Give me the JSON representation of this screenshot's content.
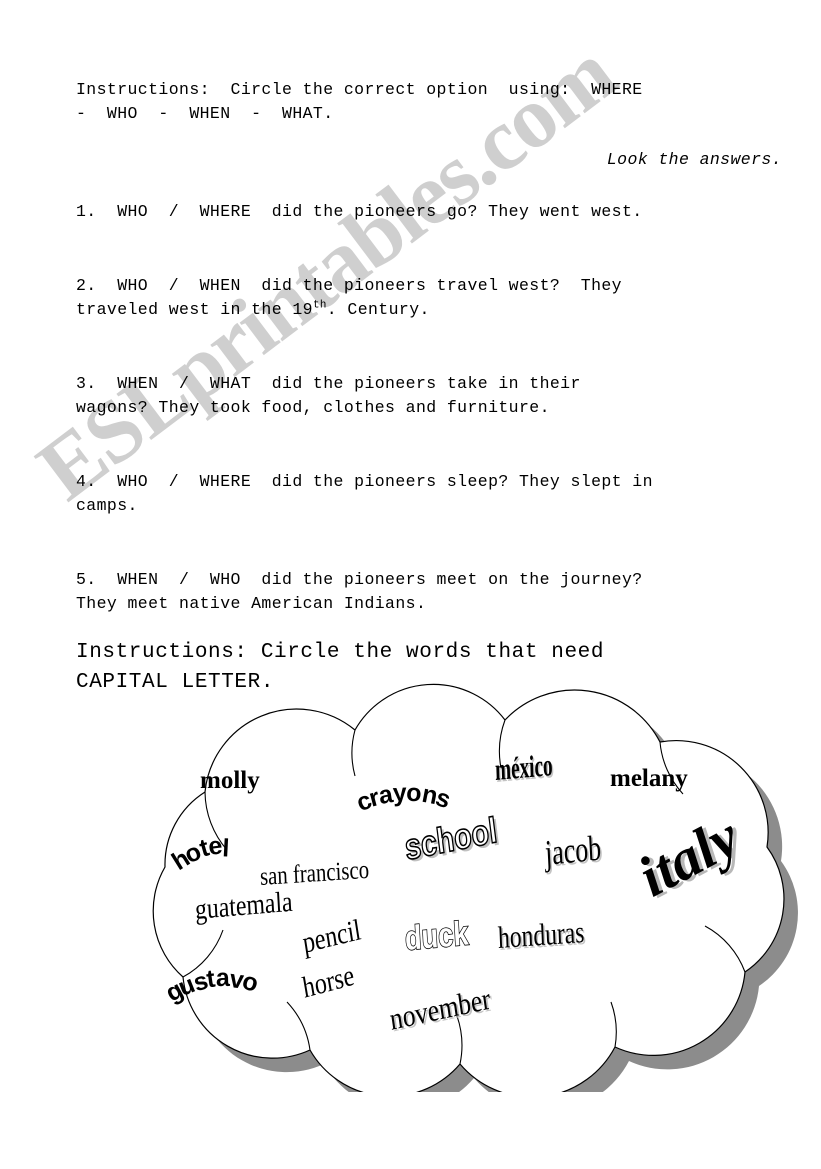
{
  "document": {
    "type": "esl-worksheet",
    "page_background": "#ffffff",
    "text_color": "#000000"
  },
  "watermark": {
    "text": "ESLprintables.com",
    "color": "#cfcfcf"
  },
  "instructions_1": {
    "line1": "Instructions:  Circle the correct option  using:  WHERE",
    "line2": "-  WHO  -  WHEN  -  WHAT.",
    "note": "Look the answers."
  },
  "questions": [
    {
      "number": "1.",
      "options": "WHO  /  WHERE",
      "line1": "1.  WHO  /  WHERE  did the pioneers go? They went west.",
      "line2": ""
    },
    {
      "number": "2.",
      "options": "WHO  /  WHEN",
      "line1": "2.  WHO  /  WHEN  did the pioneers travel west?  They",
      "line2_pre": "traveled west in the 19",
      "line2_sup": "th",
      "line2_post": ". Century."
    },
    {
      "number": "3.",
      "options": "WHEN  /  WHAT",
      "line1": "3.  WHEN  /  WHAT  did the pioneers take in their",
      "line2": "wagons? They took food, clothes and furniture."
    },
    {
      "number": "4.",
      "options": "WHO  /  WHERE",
      "line1": "4.  WHO  /  WHERE  did the pioneers sleep? They slept in",
      "line2": "camps."
    },
    {
      "number": "5.",
      "options": "WHEN  /  WHO",
      "line1": "5.  WHEN  /  WHO  did the pioneers meet on the journey?",
      "line2": "They meet native American Indians."
    }
  ],
  "instructions_2": {
    "line1": "Instructions: Circle the words that need",
    "line2": "CAPITAL LETTER."
  },
  "word_cloud": {
    "shape": "cloud",
    "outline_color": "#000000",
    "fill_color": "#ffffff",
    "shadow_color": "#8c8c8c",
    "words": [
      {
        "text": "molly",
        "style": "bold-serif"
      },
      {
        "text": "crayons",
        "style": "arched-bold-sans"
      },
      {
        "text": "méxico",
        "style": "condensed-shadow"
      },
      {
        "text": "melany",
        "style": "bold-serif"
      },
      {
        "text": "hotel",
        "style": "arched-bold-sans-rotated"
      },
      {
        "text": "san francisco",
        "style": "condensed-serif"
      },
      {
        "text": "school",
        "style": "hollow-shadow-rotated"
      },
      {
        "text": "jacob",
        "style": "condensed-serif-shadow"
      },
      {
        "text": "italy",
        "style": "large-bold-italic-serif-rotated"
      },
      {
        "text": "guatemala",
        "style": "condensed-serif"
      },
      {
        "text": "pencil",
        "style": "condensed-serif-rotated"
      },
      {
        "text": "duck",
        "style": "hollow-bold"
      },
      {
        "text": "honduras",
        "style": "condensed-serif-shadow"
      },
      {
        "text": "gustavo",
        "style": "arched-bold-sans"
      },
      {
        "text": "horse",
        "style": "condensed-serif-rotated"
      },
      {
        "text": "november",
        "style": "condensed-serif-rotated"
      }
    ]
  }
}
